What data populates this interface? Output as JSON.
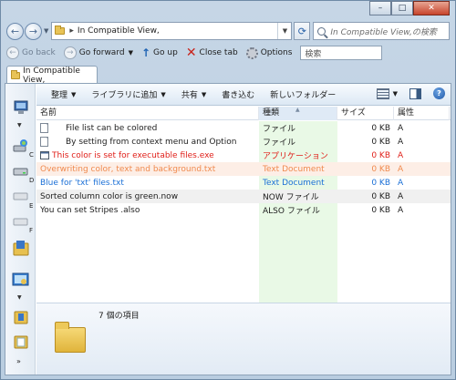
{
  "window": {
    "minimize_glyph": "–",
    "maximize_glyph": "□",
    "close_glyph": "✕"
  },
  "address": {
    "path": "In Compatible View,",
    "search_placeholder": "In Compatible View,の検索"
  },
  "quix": {
    "go_back": "Go back",
    "go_forward": "Go forward",
    "go_up": "Go up",
    "close_tab": "Close tab",
    "options": "Options",
    "search_value": "検索"
  },
  "tab": {
    "label": "In Compatible View,"
  },
  "toolbar": {
    "organize": "整理",
    "add_to_library": "ライブラリに追加",
    "share": "共有",
    "burn": "書き込む",
    "new_folder": "新しいフォルダー",
    "help_glyph": "?"
  },
  "sidebar": {
    "drive_c": "C",
    "drive_d": "D",
    "drive_e": "E",
    "drive_f": "F",
    "more": "»"
  },
  "list": {
    "columns": [
      "名前",
      "種類",
      "サイズ",
      "属性"
    ],
    "rows": [
      {
        "name": "File list can be colored",
        "type": "ファイル",
        "size": "0 KB",
        "attr": "A",
        "color": "#1e1e1e"
      },
      {
        "name": "By setting from context menu and Option",
        "type": "ファイル",
        "size": "0 KB",
        "attr": "A",
        "color": "#1e1e1e"
      },
      {
        "name": "This color is set for executable files.exe",
        "type": "アプリケーション",
        "size": "0 KB",
        "attr": "A",
        "color": "#e0201a"
      },
      {
        "name": "Overwriting color, text and background.txt",
        "type": "Text Document",
        "size": "0 KB",
        "attr": "A",
        "color": "#f08a4e"
      },
      {
        "name": "Blue for 'txt' files.txt",
        "type": "Text Document",
        "size": "0 KB",
        "attr": "A",
        "color": "#1a6fd6"
      },
      {
        "name": "Sorted column color is green.now",
        "type": "NOW ファイル",
        "size": "0 KB",
        "attr": "A",
        "color": "#1e1e1e"
      },
      {
        "name": "You can set Stripes .also",
        "type": "ALSO ファイル",
        "size": "0 KB",
        "attr": "A",
        "color": "#1e1e1e"
      }
    ]
  },
  "details": {
    "count_text": "7 個の項目"
  },
  "colors": {
    "sorted_column": "#e9f9e6",
    "stripe": "#f0f0f0",
    "highlight_row": "#fdeee6"
  }
}
